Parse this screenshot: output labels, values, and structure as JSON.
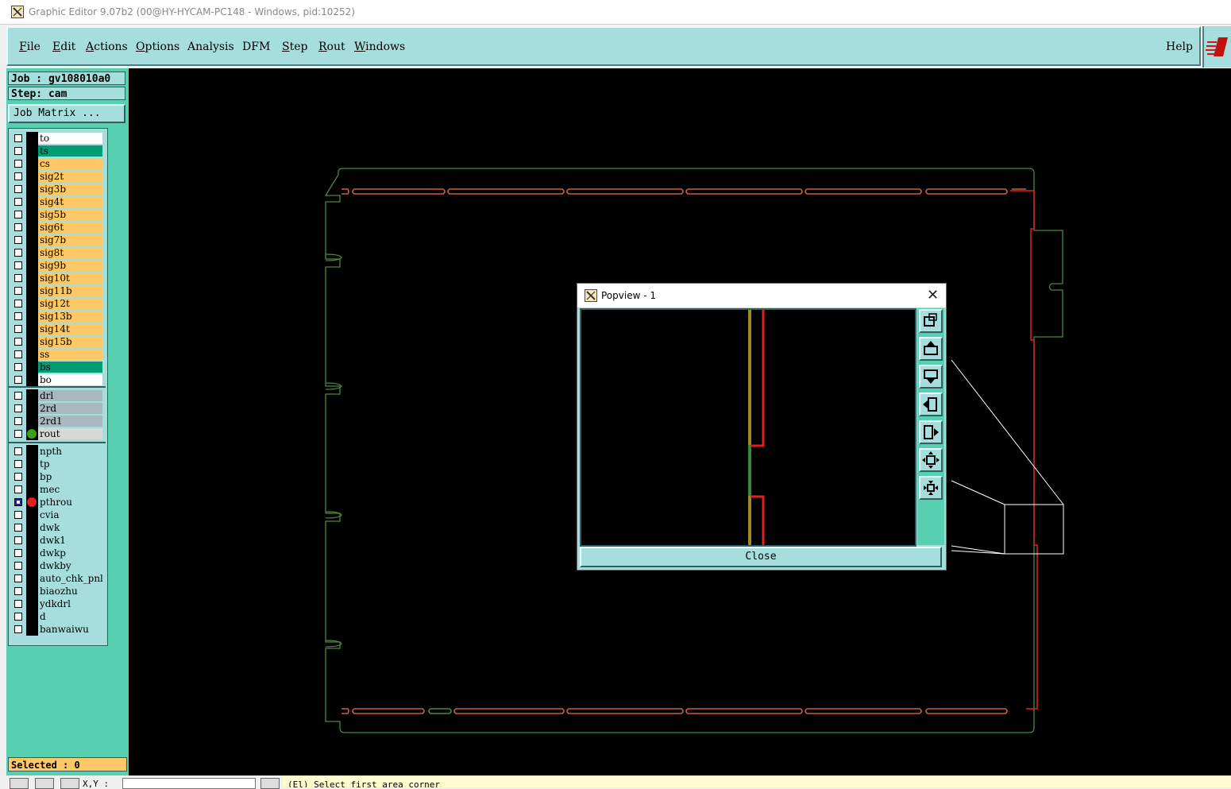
{
  "window": {
    "title": "Graphic Editor 9.07b2 (00@HY-HYCAM-PC148 - Windows, pid:10252)"
  },
  "menu": {
    "file": "File",
    "edit": "Edit",
    "actions": "Actions",
    "options": "Options",
    "analysis": "Analysis",
    "dfm": "DFM",
    "step": "Step",
    "rout": "Rout",
    "windows": "Windows",
    "help": "Help"
  },
  "info": {
    "job": "Job : gv108010a0",
    "step": "Step: cam",
    "job_matrix": "Job Matrix ..."
  },
  "layers": {
    "board": [
      {
        "name": "to",
        "color": "#ffffff"
      },
      {
        "name": "ts",
        "color": "#009c74"
      },
      {
        "name": "cs",
        "color": "#ffc866"
      },
      {
        "name": "sig2t",
        "color": "#ffc866"
      },
      {
        "name": "sig3b",
        "color": "#ffc866"
      },
      {
        "name": "sig4t",
        "color": "#ffc866"
      },
      {
        "name": "sig5b",
        "color": "#ffc866"
      },
      {
        "name": "sig6t",
        "color": "#ffc866"
      },
      {
        "name": "sig7b",
        "color": "#ffc866"
      },
      {
        "name": "sig8t",
        "color": "#ffc866"
      },
      {
        "name": "sig9b",
        "color": "#ffc866"
      },
      {
        "name": "sig10t",
        "color": "#ffc866"
      },
      {
        "name": "sig11b",
        "color": "#ffc866"
      },
      {
        "name": "sig12t",
        "color": "#ffc866"
      },
      {
        "name": "sig13b",
        "color": "#ffc866"
      },
      {
        "name": "sig14t",
        "color": "#ffc866"
      },
      {
        "name": "sig15b",
        "color": "#ffc866"
      },
      {
        "name": "ss",
        "color": "#ffc866"
      },
      {
        "name": "bs",
        "color": "#009c74"
      },
      {
        "name": "bo",
        "color": "#ffffff"
      }
    ],
    "drill": [
      {
        "name": "drl",
        "color": "#a8b8bc"
      },
      {
        "name": "2rd",
        "color": "#a8b8bc"
      },
      {
        "name": "2rd1",
        "color": "#a8b8bc"
      },
      {
        "name": "rout",
        "color": "#d8d8d8"
      }
    ],
    "misc": [
      {
        "name": "npth"
      },
      {
        "name": "tp"
      },
      {
        "name": "bp"
      },
      {
        "name": "mec"
      },
      {
        "name": "pthrou"
      },
      {
        "name": "cvia"
      },
      {
        "name": "dwk"
      },
      {
        "name": "dwk1"
      },
      {
        "name": "dwkp"
      },
      {
        "name": "dwkby"
      },
      {
        "name": "auto_chk_pnl"
      },
      {
        "name": "biaozhu"
      },
      {
        "name": "ydkdrl"
      },
      {
        "name": "d"
      },
      {
        "name": "banwaiwu"
      }
    ]
  },
  "selected": "Selected : 0",
  "popview": {
    "title": "Popview - 1",
    "close": "Close"
  },
  "status": {
    "message": "(El)   Select first area corner",
    "xy_label": "X,Y :"
  },
  "colors": {
    "teal": "#a6dedd",
    "green_panel": "#57cfb1",
    "orange": "#ffc866",
    "outline_green": "#4a8a38",
    "rout_red": "#e02020"
  }
}
